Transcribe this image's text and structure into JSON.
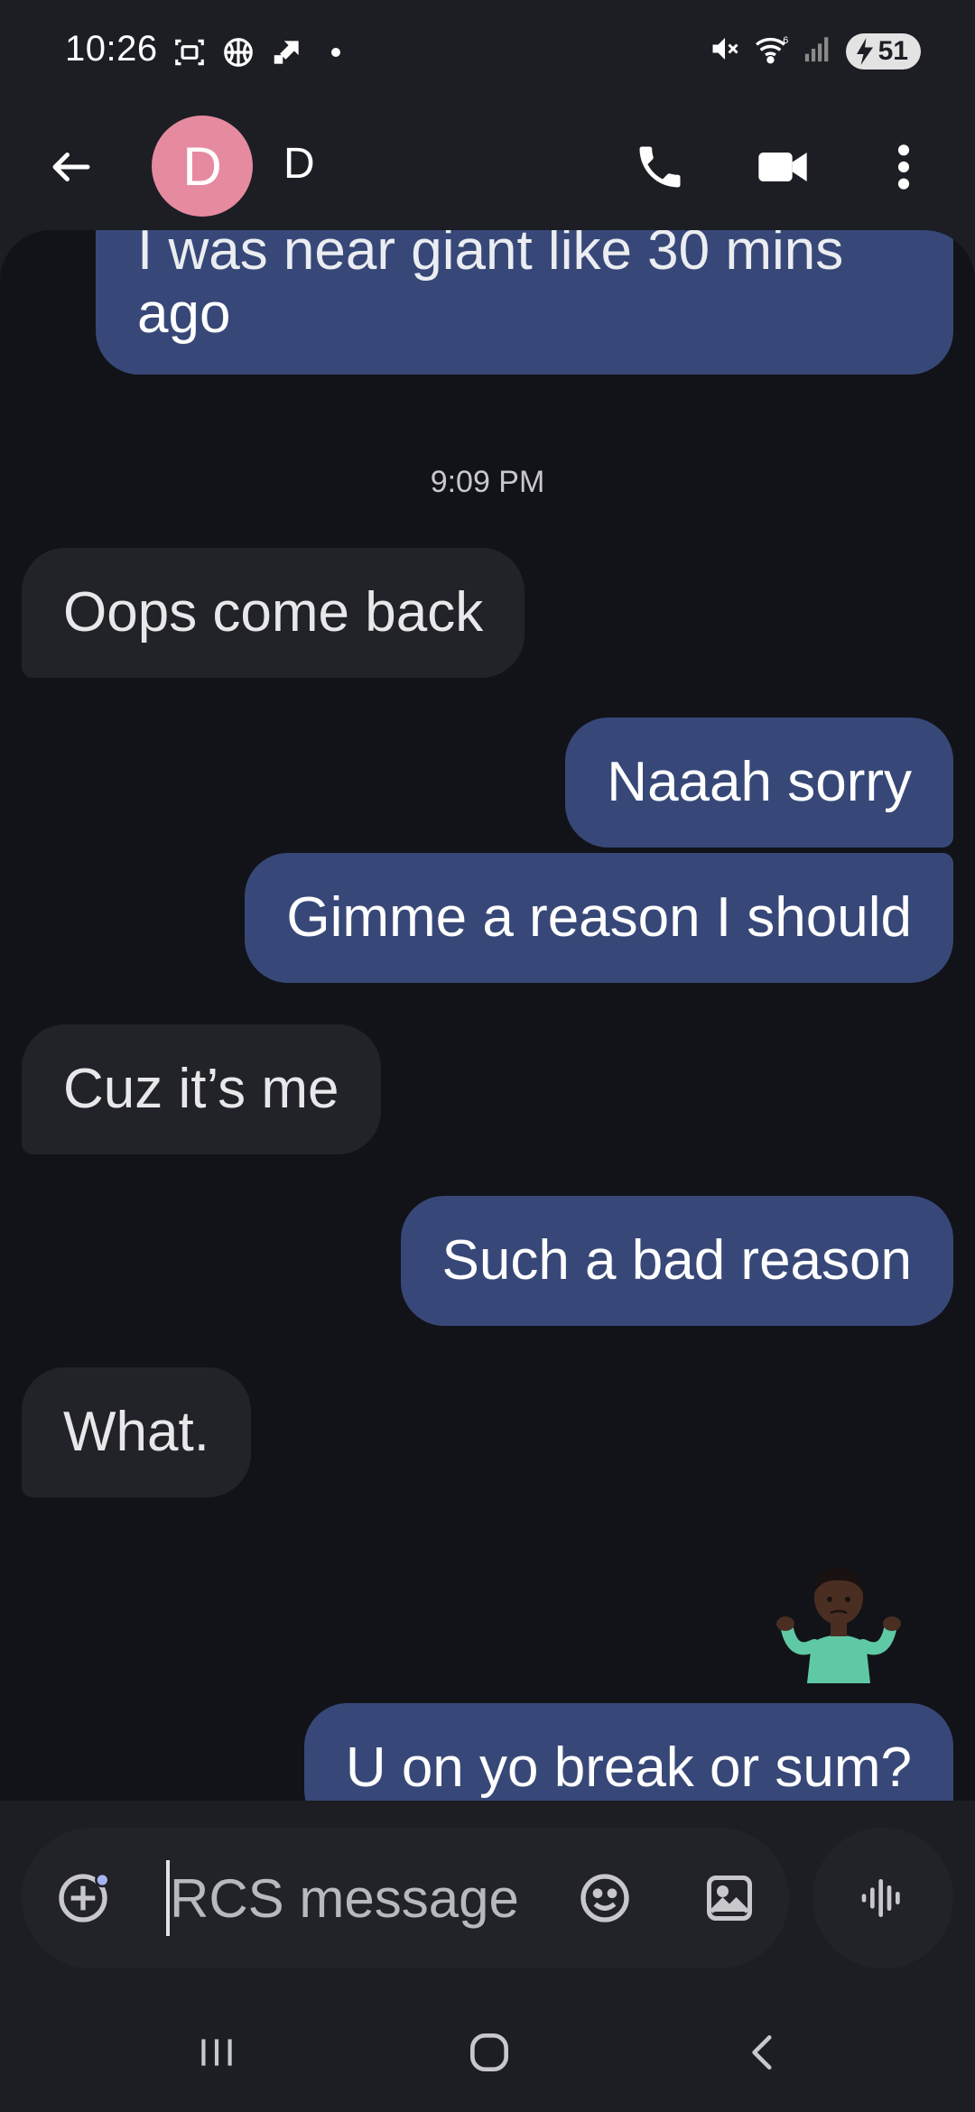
{
  "status_bar": {
    "time": "10:26",
    "battery": "51",
    "icons": [
      "screenshot-icon",
      "basketball-icon",
      "shortcut-icon",
      "dot-icon",
      "mute-icon",
      "wifi-icon",
      "signal-icon",
      "battery-charging-icon"
    ]
  },
  "header": {
    "avatar_letter": "D",
    "contact_name": "D",
    "actions": [
      "phone-icon",
      "video-call-icon",
      "more-vert-icon"
    ]
  },
  "conversation": {
    "partial_top_text": "I was near giant like 30 mins",
    "partial_top_last_line": "ago",
    "timestamp": "9:09 PM",
    "messages": [
      {
        "direction": "in",
        "text": "Oops come back"
      },
      {
        "direction": "out",
        "text": "Naaah sorry"
      },
      {
        "direction": "out",
        "text": "Gimme a reason I should"
      },
      {
        "direction": "in",
        "text": "Cuz it’s me"
      },
      {
        "direction": "out",
        "text": "Such a bad reason"
      },
      {
        "direction": "in",
        "text": "What."
      },
      {
        "direction": "out",
        "emoji": "🤷🏿‍♂️"
      },
      {
        "direction": "out",
        "text": "U on yo break or sum?"
      }
    ]
  },
  "composer": {
    "placeholder": "RCS message",
    "icons": [
      "add-icon",
      "emoji-icon",
      "image-icon",
      "voice-icon"
    ]
  },
  "colors": {
    "outgoing_bubble": "#374878",
    "incoming_bubble": "#222329",
    "background": "#121319",
    "avatar": "#e68aa0"
  }
}
